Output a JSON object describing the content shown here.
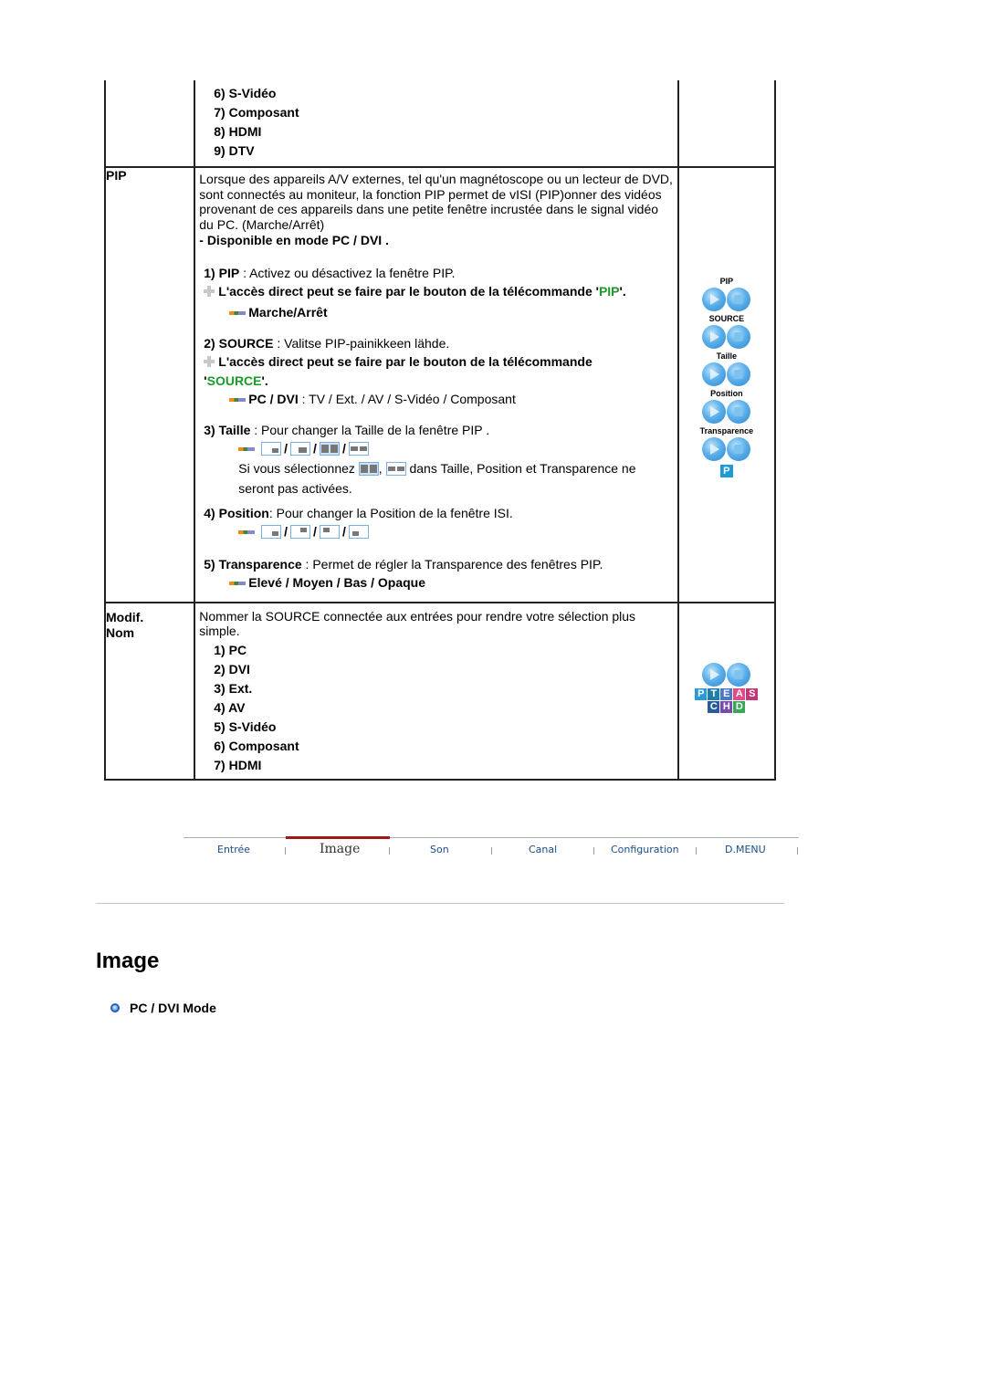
{
  "table": {
    "continued_items": [
      "6) S-Vidéo",
      "7) Composant",
      "8) HDMI",
      "9) DTV"
    ],
    "pip": {
      "label": "PIP",
      "description": "Lorsque des appareils A/V externes, tel qu'un magnétoscope ou un lecteur de DVD, sont connectés au moniteur, la fonction PIP permet de vISI (PIP)onner des vidéos provenant de ces appareils dans une petite fenêtre incrustée dans le signal vidéo du PC. (Marche/Arrêt)",
      "availability": "- Disponible en mode PC / DVI .",
      "items": {
        "pip": {
          "num": "1)",
          "name": "PIP",
          "desc": " : Activez ou désactivez la fenêtre PIP.",
          "note_prefix": "L'accès direct peut se faire par le bouton de la télécommande '",
          "note_key": "PIP",
          "note_suffix": "'.",
          "option": "Marche/Arrêt"
        },
        "source": {
          "num": "2)",
          "name": "SOURCE",
          "desc": " : Valitse PIP-painikkeen lähde.",
          "note_prefix": "L'accès direct peut se faire par le bouton de la télécommande",
          "note_key_prefix": "'",
          "note_key": "SOURCE",
          "note_suffix": "'.",
          "option_label": "PC / DVI",
          "option_values": " : TV / Ext. / AV / S-Vidéo / Composant"
        },
        "taille": {
          "num": "3)",
          "name": "Taille",
          "desc": " : Pour changer la Taille de la fenêtre PIP .",
          "note_before": "Si vous sélectionnez",
          "note_after": "dans Taille, Position et Transparence ne seront pas activées."
        },
        "position": {
          "num": "4)",
          "name": "Position",
          "desc": ": Pour changer la Position de la fenêtre ISI."
        },
        "transparence": {
          "num": "5)",
          "name": "Transparence",
          "desc": " : Permet de régler la Transparence des fenêtres PIP.",
          "options": "Elevé / Moyen / Bas / Opaque"
        }
      },
      "remote_labels": [
        "PIP",
        "SOURCE",
        "Taille",
        "Position",
        "Transparence"
      ],
      "badge": "P",
      "separator": "/"
    },
    "rename": {
      "label_line1": "Modif.",
      "label_line2": "Nom",
      "description": "Nommer la SOURCE connectée aux entrées pour rendre votre sélection plus simple.",
      "items": [
        "1) PC",
        "2) DVI",
        "3) Ext.",
        "4) AV",
        "5) S-Vidéo",
        "6) Composant",
        "7) HDMI"
      ],
      "letters_row1": [
        "P",
        "T",
        "E",
        "A",
        "S"
      ],
      "letters_row2": [
        "C",
        "H",
        "D"
      ],
      "letter_colors": {
        "P": "#2a9ad6",
        "T": "#1f7fa8",
        "E": "#4a78c8",
        "A": "#e24a8a",
        "S": "#c03878",
        "C": "#2a5c9a",
        "H": "#7a4ab0",
        "D": "#3aa858"
      }
    }
  },
  "nav": {
    "items": [
      "Entrée",
      "Image",
      "Son",
      "Canal",
      "Configuration",
      "D.MENU"
    ],
    "active": "Image",
    "active_color": "#a01818"
  },
  "page": {
    "title": "Image",
    "section": "PC / DVI Mode"
  }
}
